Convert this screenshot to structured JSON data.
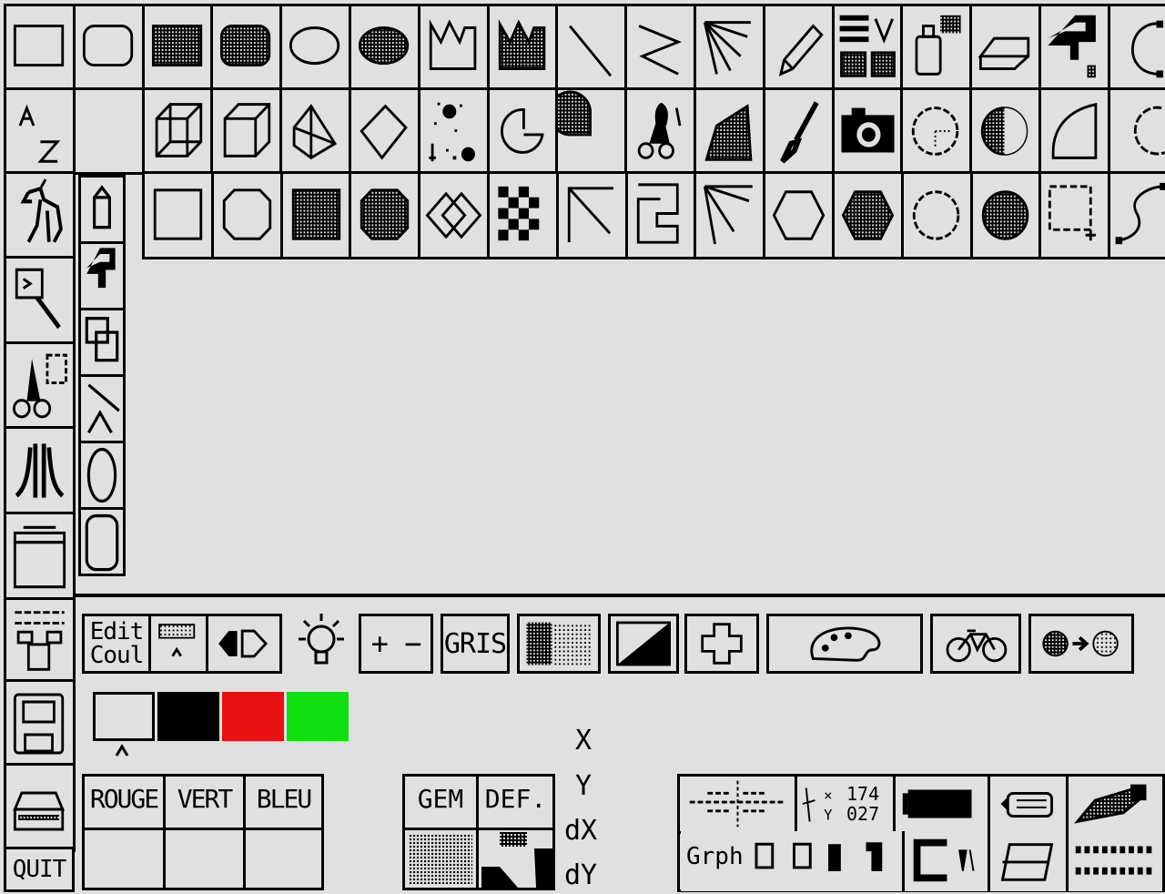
{
  "colors": {
    "background": "#e0e0e0",
    "ink": "#000000",
    "palette": [
      "#e0e0e0",
      "#000000",
      "#e81010",
      "#10e010"
    ]
  },
  "toolbar_row1": [
    "rectangle-icon",
    "rounded-rectangle-icon",
    "filled-rectangle-icon",
    "filled-rounded-rectangle-icon",
    "ellipse-icon",
    "filled-ellipse-icon",
    "polygon-icon",
    "filled-polygon-icon",
    "line-icon",
    "polyline-icon",
    "rays-icon",
    "pencil-icon",
    "pattern-selector-icon",
    "spray-icon",
    "eraser-icon",
    "fill-tap-icon",
    "arc-icon"
  ],
  "toolbar_row2": [
    "text-az-icon",
    "empty-slot",
    "wire-cube-icon",
    "solid-cube-icon",
    "pyramid-icon",
    "diamond-icon",
    "airbrush-dots-icon",
    "pie-outline-icon",
    "pie-filled-icon",
    "scissors-icon",
    "filled-trapezoid-icon",
    "brush-icon",
    "camera-icon",
    "dotted-circle-icon",
    "filled-circle-shade-icon",
    "quarter-arc-icon",
    "partial-circle-icon"
  ],
  "toolbar_row3": [
    "square-icon",
    "octagon-icon",
    "filled-square-icon",
    "filled-octagon-icon",
    "double-diamond-icon",
    "checker-icon",
    "corner-line-icon",
    "spiral-icon",
    "fan-lines-icon",
    "hexagon-icon",
    "filled-hexagon-icon",
    "dotted-circle-small-icon",
    "filled-circle-icon",
    "selection-icon",
    "curve-icon"
  ],
  "left_tools": [
    "horse-icon",
    "magnifier-icon",
    "cut-paste-icon",
    "atari-logo-icon",
    "jar-icon",
    "sliders-icon",
    "floppy-disk-icon",
    "printer-icon"
  ],
  "sub_tools": [
    "pencil-small-icon",
    "tap-small-icon",
    "copy-frames-icon",
    "lines-v-icon",
    "ellipse-vertical-icon",
    "rounded-rect-vertical-icon"
  ],
  "quit_label": "QUIT",
  "color_bar": {
    "edit_label_1": "Edit",
    "edit_label_2": "Coul",
    "plus_minus": "+ −",
    "gris_label": "GRIS"
  },
  "rgb_headers": [
    "ROUGE",
    "VERT",
    "BLEU"
  ],
  "gem_label": "GEM",
  "def_label": "DEF.",
  "coords": {
    "x": "X",
    "y": "Y",
    "dx": "dX",
    "dy": "dY"
  },
  "readout": {
    "x_value": "174",
    "y_value": "027",
    "grph_label": "Grph"
  }
}
